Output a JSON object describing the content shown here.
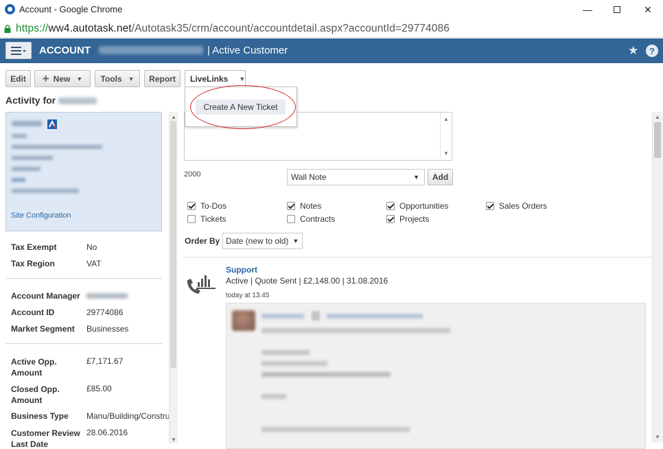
{
  "window": {
    "title": "Account - Google Chrome",
    "url_scheme": "https://",
    "url_host": "ww4.autotask.net",
    "url_path": "/Autotask35/crm/account/accountdetail.aspx?accountId=29774086"
  },
  "header": {
    "section": "ACCOUNT",
    "status": "| Active Customer"
  },
  "toolbar": {
    "edit": "Edit",
    "new": "New",
    "tools": "Tools",
    "report": "Report",
    "livelinks": "LiveLinks",
    "dropdown_item": "Create A New Ticket"
  },
  "sidebar": {
    "activity_prefix": "Activity for",
    "card": {
      "site_configuration": "Site Configuration"
    },
    "fields1": [
      {
        "label": "Tax Exempt",
        "value": "No"
      },
      {
        "label": "Tax Region",
        "value": "VAT"
      }
    ],
    "fields2": [
      {
        "label": "Account Manager",
        "value": ""
      },
      {
        "label": "Account ID",
        "value": "29774086"
      },
      {
        "label": "Market Segment",
        "value": "Businesses"
      }
    ],
    "fields3": [
      {
        "label_line1": "Active Opp.",
        "label_line2": "Amount",
        "value": "£7,171.67"
      },
      {
        "label_line1": "Closed Opp.",
        "label_line2": "Amount",
        "value": "£85.00"
      },
      {
        "label": "Business Type",
        "value": "Manu/Building/Construction"
      },
      {
        "label_line1": "Customer Review",
        "label_line2": "Last Date",
        "value": "28.06.2016"
      }
    ]
  },
  "composer": {
    "char_count": "2000",
    "note_type": "Wall Note",
    "add": "Add"
  },
  "filters": {
    "todos": "To-Dos",
    "notes": "Notes",
    "opportunities": "Opportunities",
    "sales_orders": "Sales Orders",
    "tickets": "Tickets",
    "contracts": "Contracts",
    "projects": "Projects"
  },
  "order": {
    "label": "Order By",
    "value": "Date (new to old)"
  },
  "feed": {
    "title": "Support",
    "subtitle": "Active | Quote Sent | £2,148.00 | 31.08.2016",
    "time": "today at 13:45"
  },
  "icons": {
    "menu": "hamburger-menu-icon",
    "star": "star-icon",
    "help": "help-icon",
    "lock": "lock-icon",
    "phone": "phone-chart-icon"
  },
  "colors": {
    "header_blue": "#336596",
    "link_blue": "#2966a3",
    "annotation_red": "#d62828"
  }
}
